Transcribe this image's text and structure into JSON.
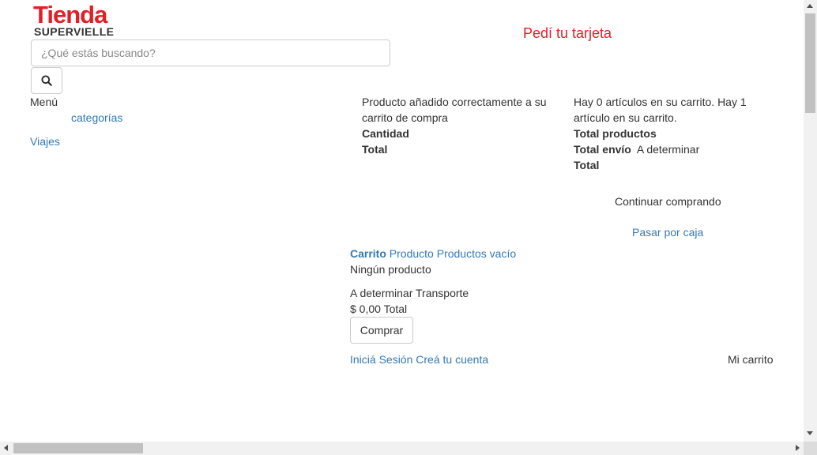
{
  "header": {
    "logo_top": "Tienda",
    "logo_bottom": "SUPERVIELLE",
    "promo_link": "Pedí tu tarjeta",
    "search": {
      "placeholder": "¿Qué estás buscando?",
      "value": ""
    },
    "search_icon": "search-icon"
  },
  "nav": {
    "menu_label": "Menú",
    "categories_label": "categorías",
    "travel_label": "Viajes"
  },
  "modal": {
    "added_message": "Producto añadido correctamente a su carrito de compra",
    "quantity_label": "Cantidad",
    "total_label": "Total",
    "cart_count_message": "Hay 0 artículos en su carrito. Hay 1 artículo en su carrito.",
    "total_products_label": "Total productos",
    "total_shipping_label": "Total envío",
    "total_shipping_value": "A determinar",
    "cart_total_label": "Total",
    "continue_label": "Continuar comprando",
    "checkout_label": "Pasar por caja"
  },
  "cart": {
    "title": "Carrito",
    "product_label": "Producto",
    "products_empty_label": "Productos vacío",
    "no_product": "Ningún producto",
    "shipping_value": "A determinar",
    "shipping_label": "Transporte",
    "total_value": "$ 0,00",
    "total_label": "Total",
    "buy_label": "Comprar"
  },
  "account": {
    "login_label": "Iniciá Sesión",
    "register_label": "Creá tu cuenta",
    "my_cart_label": "Mi carrito"
  },
  "colors": {
    "brand_red": "#e21e26",
    "link_blue": "#337ab7",
    "text": "#333333"
  }
}
